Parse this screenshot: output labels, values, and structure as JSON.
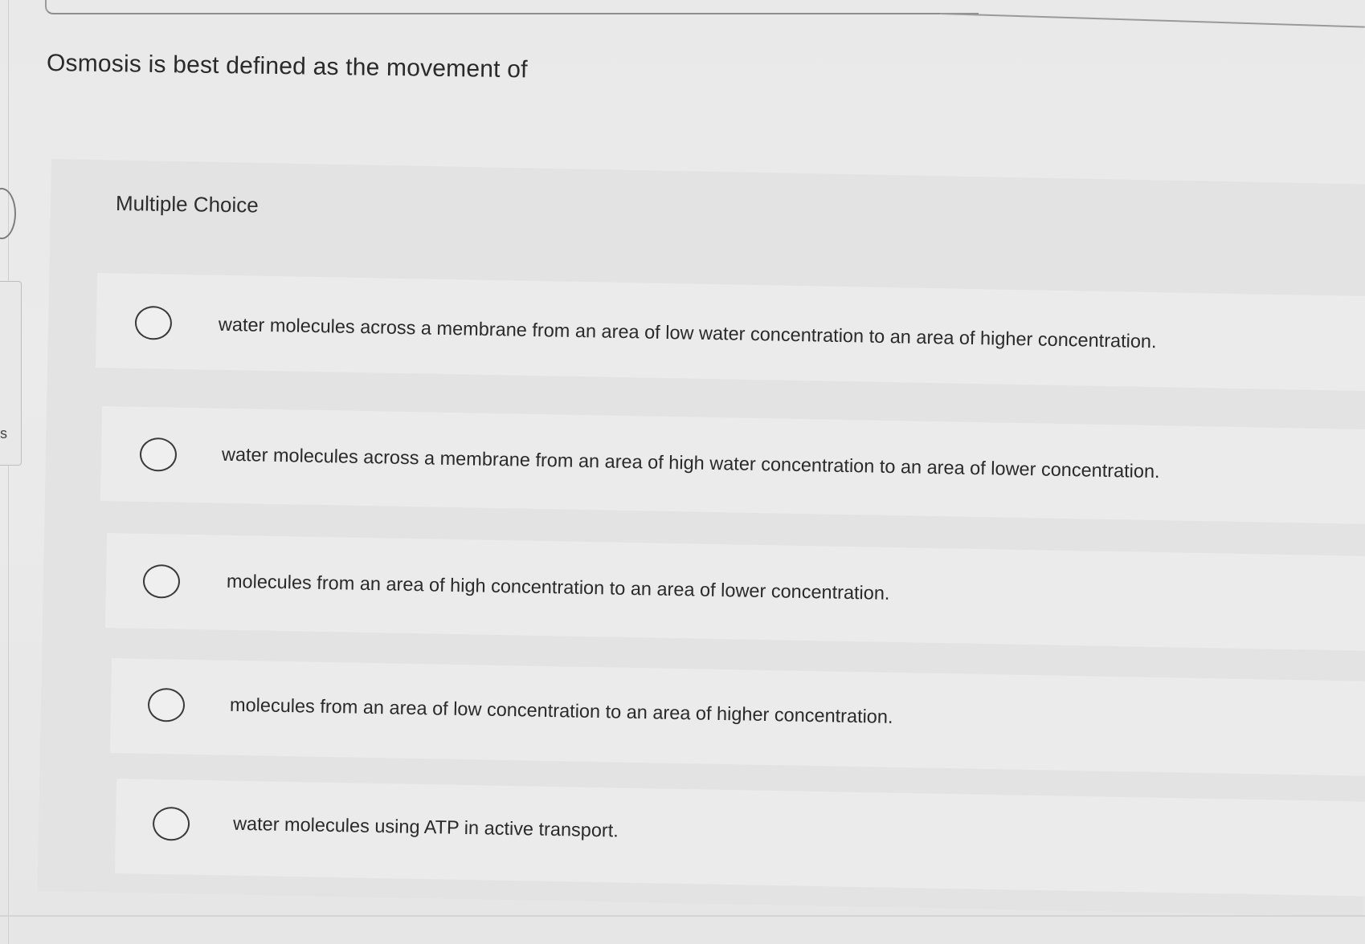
{
  "question": {
    "text": "Osmosis is best defined as the movement of"
  },
  "section": {
    "label": "Multiple Choice"
  },
  "options": [
    {
      "text": "water molecules across a membrane from an area of low water concentration to an area of higher concentration."
    },
    {
      "text": "water molecules across a membrane from an area of high water concentration to an area of lower concentration."
    },
    {
      "text": "molecules from an area of high concentration to an area of lower concentration."
    },
    {
      "text": "molecules from an area of low concentration to an area of higher concentration."
    },
    {
      "text": "water molecules using ATP in active transport."
    }
  ],
  "left_edge_glyph": "s",
  "colors": {
    "background": "#ebebeb",
    "panel": "#e3e3e3",
    "text": "#2a2a2a",
    "radio_border": "#3a3a3a"
  }
}
